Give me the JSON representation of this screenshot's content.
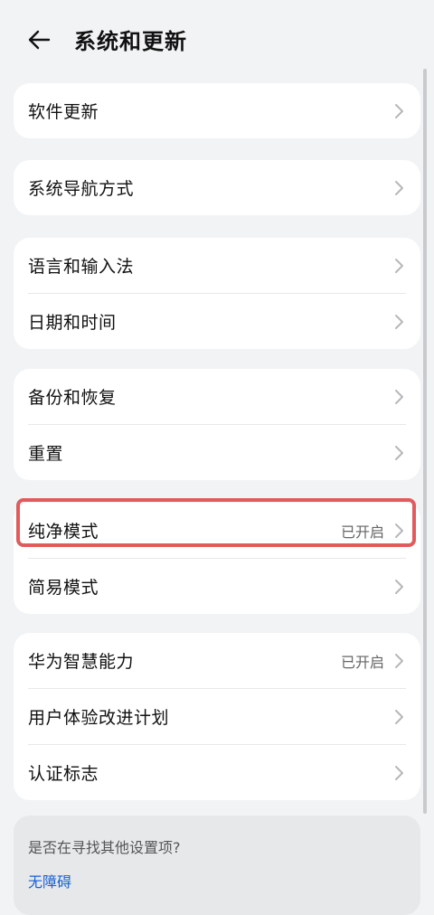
{
  "header": {
    "title": "系统和更新"
  },
  "groups": [
    {
      "items": [
        {
          "label": "软件更新",
          "status": ""
        }
      ]
    },
    {
      "items": [
        {
          "label": "系统导航方式",
          "status": ""
        }
      ]
    },
    {
      "items": [
        {
          "label": "语言和输入法",
          "status": ""
        },
        {
          "label": "日期和时间",
          "status": ""
        }
      ]
    },
    {
      "items": [
        {
          "label": "备份和恢复",
          "status": ""
        },
        {
          "label": "重置",
          "status": ""
        }
      ]
    },
    {
      "items": [
        {
          "label": "纯净模式",
          "status": "已开启"
        },
        {
          "label": "简易模式",
          "status": ""
        }
      ]
    },
    {
      "items": [
        {
          "label": "华为智慧能力",
          "status": "已开启"
        },
        {
          "label": "用户体验改进计划",
          "status": ""
        },
        {
          "label": "认证标志",
          "status": ""
        }
      ]
    }
  ],
  "footer": {
    "question": "是否在寻找其他设置项?",
    "link": "无障碍"
  },
  "colors": {
    "background": "#f1f3f5",
    "card": "#ffffff",
    "highlight": "#e25b5c",
    "link": "#1a5fd6"
  }
}
